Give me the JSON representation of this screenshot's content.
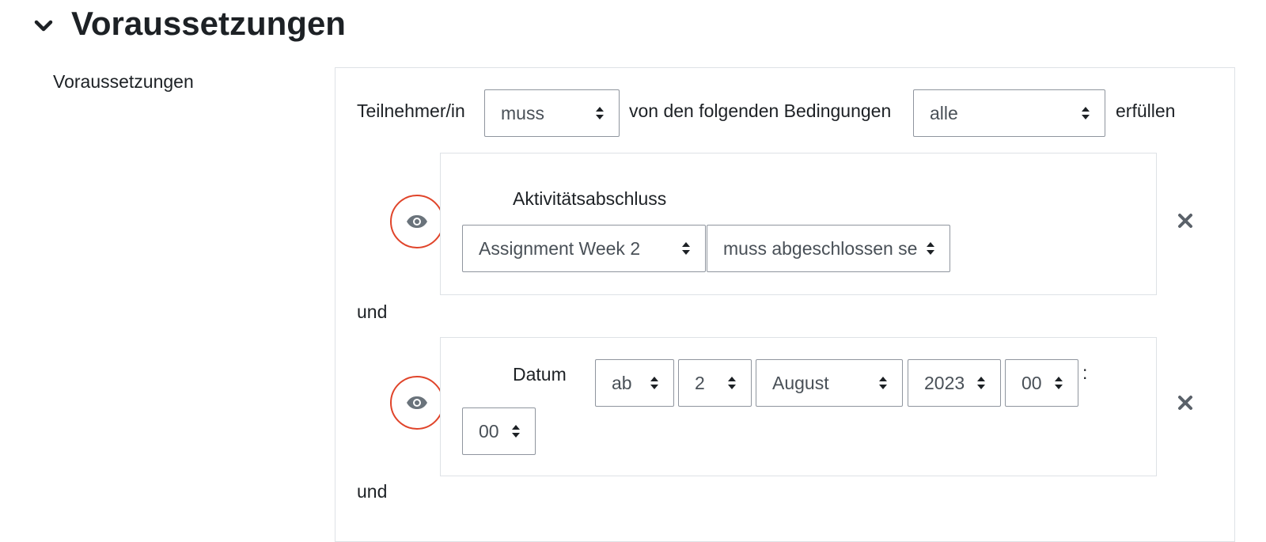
{
  "section": {
    "title": "Voraussetzungen",
    "field_label": "Voraussetzungen"
  },
  "restriction": {
    "prefix": "Teilnehmer/in",
    "must_select": "muss",
    "middle": "von den folgenden Bedingungen",
    "all_select": "alle",
    "suffix": "erfüllen"
  },
  "conditions": [
    {
      "title": "Aktivitätsabschluss",
      "activity_select": "Assignment Week 2",
      "status_select": "muss abgeschlossen sein"
    },
    {
      "title": "Datum",
      "direction_select": "ab",
      "day_select": "2",
      "month_select": "August",
      "year_select": "2023",
      "hour_select": "00",
      "colon": ":",
      "minute_select": "00"
    }
  ],
  "connectors": [
    "und",
    "und"
  ],
  "colors": {
    "eye_ring": "#e0442a",
    "border": "#dee2e6",
    "select_border": "#8f959e"
  },
  "icons": [
    "chevron-down-icon",
    "eye-icon",
    "close-icon",
    "select-arrows-icon"
  ]
}
